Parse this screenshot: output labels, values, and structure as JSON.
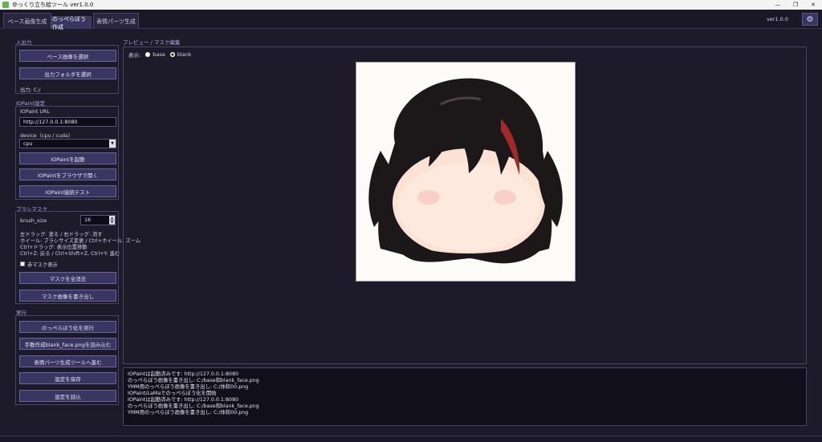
{
  "window": {
    "title": "ゆっくり立ち絵ツール ver1.0.0",
    "controls": [
      "—",
      "❐",
      "✕"
    ]
  },
  "tabs": [
    {
      "label": "ベース画像生成",
      "active": false
    },
    {
      "label": "のっぺらぼう作成",
      "active": true
    },
    {
      "label": "表情パーツ生成",
      "active": false
    }
  ],
  "header": {
    "version": "ver1.0.0",
    "settings_icon": "gear-icon"
  },
  "io": {
    "section": "入出力",
    "select_base": "ベース画像を選択",
    "select_output": "出力フォルダを選択",
    "output_path": "出力: C:/"
  },
  "iopaint": {
    "section": "IOPaint設定",
    "url_label": "IOPaint URL",
    "url_value": "http://127.0.0.1:8080",
    "device_label": "device（cpu / cuda）",
    "device_value": "cpu",
    "start": "IOPaintを起動",
    "open_browser": "IOPaintをブラウザで開く",
    "test": "IOPaint接続テスト"
  },
  "brush": {
    "section": "ブラシマスク",
    "size_label": "brush_size",
    "size_value": "16",
    "help": [
      "左ドラッグ: 塗る / 右ドラッグ: 消す",
      "ホイール: ブラシサイズ変更 / Ctrl+ホイール: ズーム",
      "Ctrl+ドラッグ: 表示位置移動",
      "Ctrl+Z: 戻る / Ctrl+Shift+Z, Ctrl+Y: 進む"
    ],
    "show_red_mask": "赤マスク表示",
    "show_red_mask_checked": false,
    "clear_mask": "マスクを全消去",
    "export_mask": "マスク画像を書き出し"
  },
  "run": {
    "section": "実行",
    "execute": "のっぺらぼう化を実行",
    "load_manual": "手動作成blank_face.pngを読み込む",
    "go_parts": "表情パーツ生成ツールへ進む",
    "save_settings": "設定を保存",
    "load_settings": "設定を読込"
  },
  "preview": {
    "section": "プレビュー / マスク編集",
    "display_label": "表示:",
    "options": [
      "base",
      "blank"
    ],
    "selected": "blank"
  },
  "log": [
    "IOPaintは起動済みです: http://127.0.0.1:8080",
    "のっぺらぼう画像を書き出し: C:/base和blank_face.png",
    "YMM用のっぺらぼう画像を書き出し: C:/体和00.png",
    "IOPaint/LaMaでのっぺらぼう化を開始",
    "IOPaintは起動済みです: http://127.0.0.1:8080",
    "のっぺらぼう画像を書き出し: C:/base和blank_face.png",
    "YMM用のっぺらぼう画像を書き出し: C:/体和00.png"
  ]
}
